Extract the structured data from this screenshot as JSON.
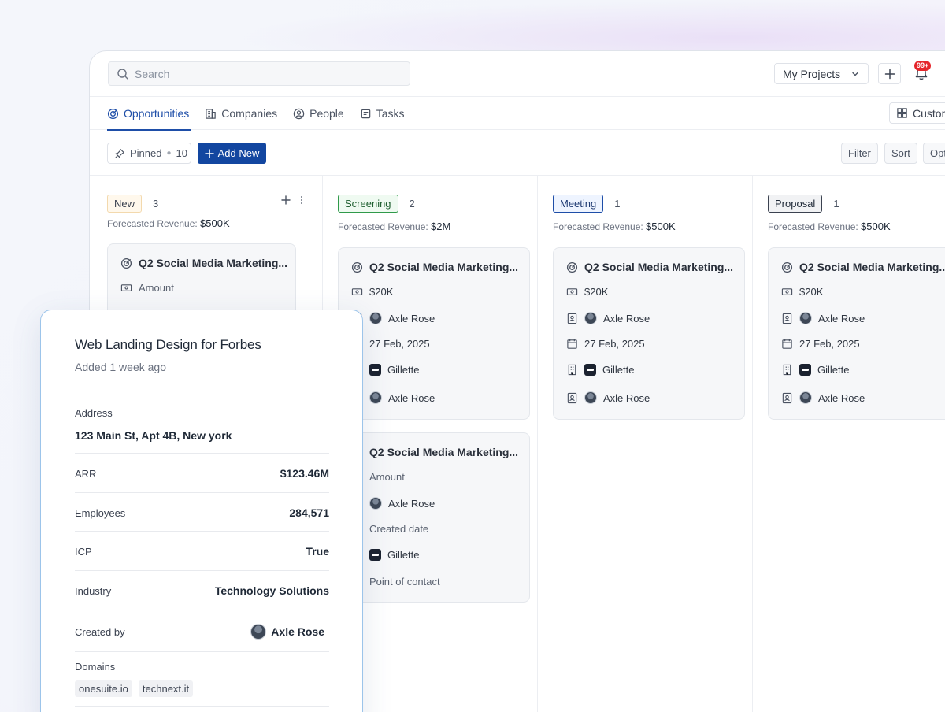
{
  "header": {
    "search_placeholder": "Search",
    "projects_label": "My Projects",
    "notifications_badge": "99+"
  },
  "tabs": [
    {
      "label": "Opportunities",
      "active": true
    },
    {
      "label": "Companies"
    },
    {
      "label": "People"
    },
    {
      "label": "Tasks"
    }
  ],
  "customize_label": "Customize",
  "toolbar": {
    "pinned_label": "Pinned",
    "pinned_count": "10",
    "add_new_label": "Add New",
    "filter_label": "Filter",
    "sort_label": "Sort",
    "options_label": "Options"
  },
  "forecast_label": "Forecasted Revenue:",
  "columns": [
    {
      "stage": "New",
      "count": "3",
      "forecast": "$500K",
      "cards": [
        {
          "title": "Q2 Social Media Marketing...",
          "amount": "Amount"
        }
      ]
    },
    {
      "stage": "Screening",
      "count": "2",
      "forecast": "$2M",
      "cards": [
        {
          "title": "Q2 Social Media Marketing...",
          "amount": "$20K",
          "owner": "Axle Rose",
          "date": "27 Feb, 2025",
          "company": "Gillette",
          "contact": "Axle Rose"
        },
        {
          "title": "Q2 Social Media Marketing...",
          "amount": "Amount",
          "owner": "Axle Rose",
          "date": "Created date",
          "company": "Gillette",
          "contact": "Point of contact"
        }
      ]
    },
    {
      "stage": "Meeting",
      "count": "1",
      "forecast": "$500K",
      "cards": [
        {
          "title": "Q2 Social Media Marketing...",
          "amount": "$20K",
          "owner": "Axle Rose",
          "date": "27 Feb, 2025",
          "company": "Gillette",
          "contact": "Axle Rose"
        }
      ]
    },
    {
      "stage": "Proposal",
      "count": "1",
      "forecast": "$500K",
      "cards": [
        {
          "title": "Q2 Social Media Marketing...",
          "amount": "$20K",
          "owner": "Axle Rose",
          "date": "27 Feb, 2025",
          "company": "Gillette",
          "contact": "Axle Rose"
        }
      ]
    }
  ],
  "stage_colors": {
    "new": {
      "bg": "#fff8ec",
      "border": "#f3d9ad"
    },
    "screening": {
      "bg": "#effaf1",
      "border": "#2f9a4a"
    },
    "meeting": {
      "bg": "#eef4ff",
      "border": "#1e4ea8"
    },
    "proposal": {
      "bg": "#f1f2f4",
      "border": "#3b4250"
    }
  },
  "panel": {
    "title": "Web Landing Design for Forbes",
    "subtitle": "Added 1 week ago",
    "address_label": "Address",
    "address_value": "123 Main St, Apt 4B, New york",
    "arr_label": "ARR",
    "arr_value": "$123.46M",
    "employees_label": "Employees",
    "employees_value": "284,571",
    "icp_label": "ICP",
    "icp_value": "True",
    "industry_label": "Industry",
    "industry_value": "Technology Solutions",
    "created_by_label": "Created by",
    "created_by_value": "Axle Rose",
    "domains_label": "Domains",
    "domains": [
      "onesuite.io",
      "technext.it"
    ]
  }
}
